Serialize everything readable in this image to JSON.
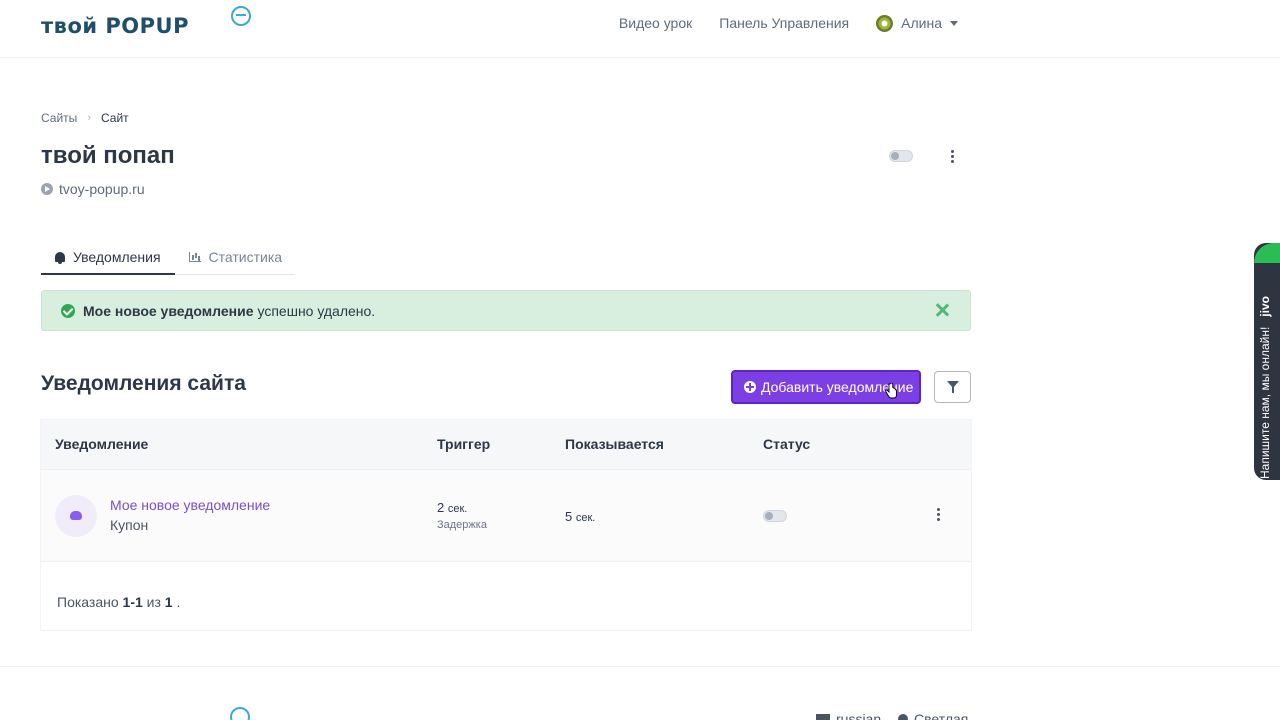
{
  "header": {
    "logo_text": "твой POPUP",
    "nav": {
      "video": "Видео урок",
      "dashboard": "Панель Управления",
      "user": "Алина"
    }
  },
  "breadcrumb": {
    "sites": "Сайты",
    "separator": "›",
    "current": "Сайт"
  },
  "site": {
    "title": "твой попап",
    "url": "tvoy-popup.ru"
  },
  "tabs": [
    {
      "label": "Уведомления",
      "active": true
    },
    {
      "label": "Статистика",
      "active": false
    }
  ],
  "alert": {
    "bold": "Мое новое уведомление",
    "text": "успешно удалено."
  },
  "section": {
    "title": "Уведомления сайта",
    "add_button": "Добавить уведомление"
  },
  "table": {
    "headers": {
      "notification": "Уведомление",
      "trigger": "Триггер",
      "shown": "Показывается",
      "status": "Статус"
    },
    "rows": [
      {
        "name": "Мое новое уведомление",
        "type": "Купон",
        "trigger_value": "2",
        "trigger_unit": "сек.",
        "trigger_label": "Задержка",
        "shown_value": "5",
        "shown_unit": "сек.",
        "status_enabled": false
      }
    ],
    "footer": {
      "prefix": "Показано",
      "range": "1-1",
      "of": "из",
      "total": "1",
      "suffix": "."
    }
  },
  "footer": {
    "language": "russian",
    "theme": "Светлая"
  },
  "jivo": {
    "text": "Напишите нам, мы онлайн!",
    "brand": "jivo"
  },
  "colors": {
    "accent": "#7b3fe4",
    "success_bg": "#d8efdf",
    "success": "#2fa84f",
    "link": "#7b4fc8"
  }
}
